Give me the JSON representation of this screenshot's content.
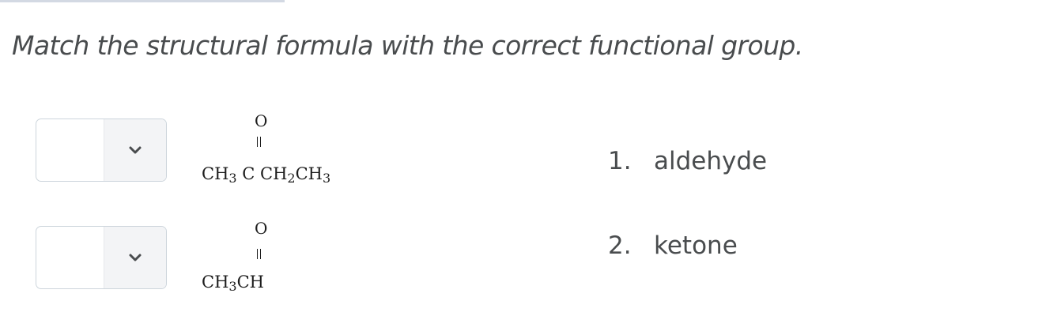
{
  "question": {
    "text": "Match the structural formula with the correct functional group."
  },
  "matches": [
    {
      "selected_value": "",
      "icon": "chevron-down-icon",
      "formula": {
        "oxygen": "O",
        "chain": [
          {
            "text": "CH",
            "sub": "3"
          },
          {
            "text": " C ",
            "sub": ""
          },
          {
            "text": "CH",
            "sub": "2"
          },
          {
            "text": "CH",
            "sub": "3"
          }
        ]
      }
    },
    {
      "selected_value": "",
      "icon": "chevron-down-icon",
      "formula": {
        "oxygen": "O",
        "chain": [
          {
            "text": "CH",
            "sub": "3"
          },
          {
            "text": "CH",
            "sub": ""
          }
        ]
      }
    }
  ],
  "answers": [
    {
      "number": "1.",
      "label": "aldehyde"
    },
    {
      "number": "2.",
      "label": "ketone"
    }
  ]
}
